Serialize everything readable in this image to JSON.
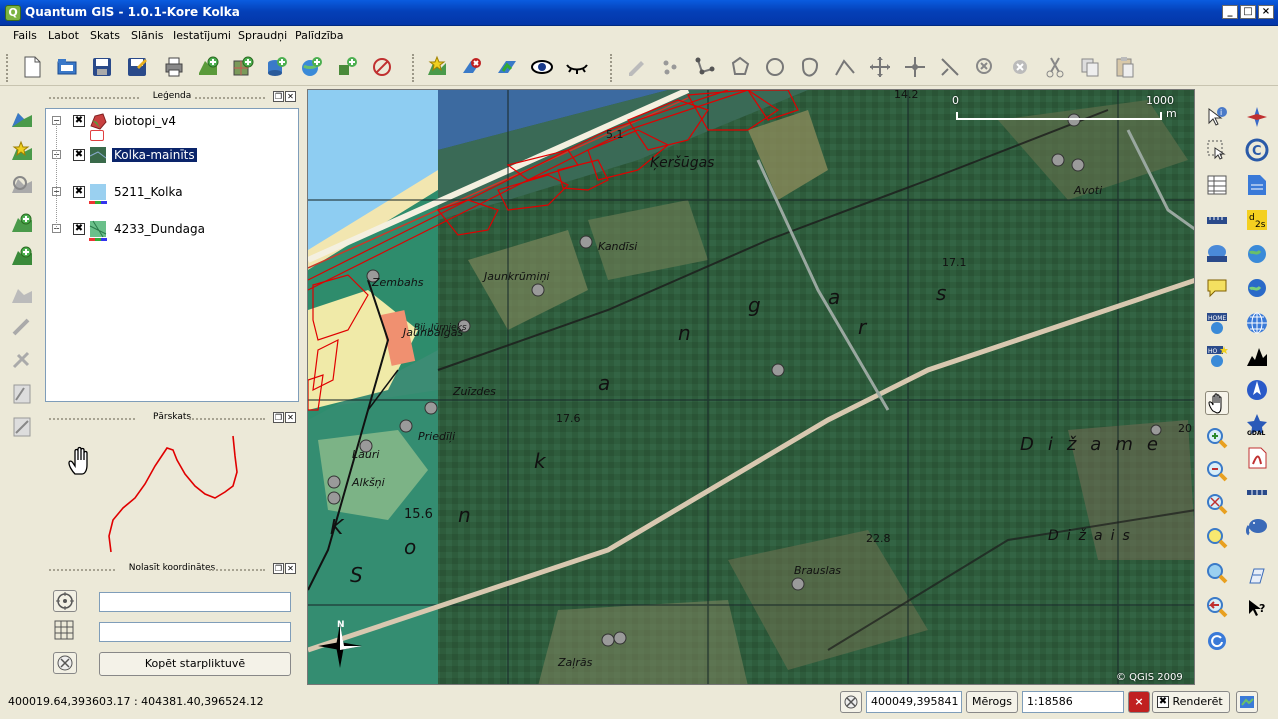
{
  "window": {
    "title": "Quantum GIS - 1.0.1-Kore  Kolka",
    "app_icon": "Q",
    "minimize": "_",
    "maximize": "□",
    "close": "×"
  },
  "menu": [
    "Fails",
    "Labot",
    "Skats",
    "Slānis",
    "Iestatījumi",
    "Spraudņi",
    "Palīdzība"
  ],
  "legend": {
    "title": "Leģenda",
    "layers": [
      {
        "name": "biotopi_v4",
        "checked": "✖",
        "expand": "−",
        "selected": false,
        "icon": "polygon-layer-icon"
      },
      {
        "name": "Kolka-mainīts",
        "checked": "✖",
        "expand": "−",
        "selected": true,
        "icon": "raster-layer-icon"
      },
      {
        "name": "5211_Kolka",
        "checked": "✖",
        "expand": "−",
        "selected": false,
        "icon": "raster-layer-icon"
      },
      {
        "name": "4233_Dundaga",
        "checked": "✖",
        "expand": "−",
        "selected": false,
        "icon": "raster-layer-icon"
      }
    ]
  },
  "overview": {
    "title": "Pārskats"
  },
  "coordinates_panel": {
    "title": "Nolasīt koordinātes",
    "field1": "",
    "field2": "",
    "copy_button": "Kopēt starpliktuvē"
  },
  "map": {
    "scalebar_start": "0",
    "scalebar_end": "1000",
    "scalebar_unit": "m",
    "copyright": "© QGIS 2009",
    "north_label": "N",
    "labels": [
      "Zembahs",
      "Jaunbalgas",
      "Bij. Jūrnieks",
      "Zuīzdes",
      "Priedīļi",
      "Lauri",
      "Alkšņi",
      "Kandīsi",
      "Jaunkrūmiņi",
      "Avoti",
      "Brauslas",
      "Zaļrās",
      "Ķeršūgas",
      "Dižame",
      "Dižais",
      "17.1",
      "17.6",
      "15.6",
      "22.8",
      "14.2",
      "5.1",
      "20"
    ]
  },
  "status": {
    "coords": "400019.64,393603.17 : 404381.40,396524.12",
    "cursor_coord": "400049,395841",
    "scale_label": "Mērogs",
    "scale_value": "1:18586",
    "render_label": "Renderēt",
    "render_checked": "✖",
    "stop_icon": "×"
  },
  "colors": {
    "title_bar": "#0440b8",
    "selection": "#0a246a",
    "vector_outline": "#e00000",
    "map_forest": "#2c5a3a"
  }
}
